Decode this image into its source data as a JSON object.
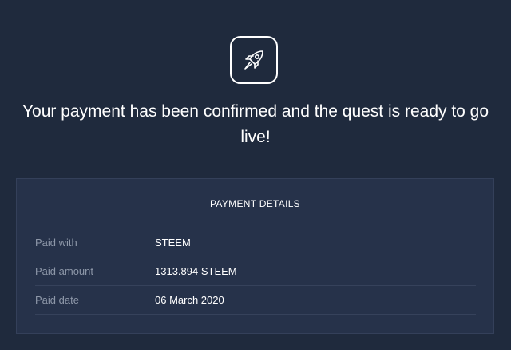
{
  "icon": "rocket-icon",
  "headline": "Your payment has been confirmed and the quest is ready to go live!",
  "payment_details": {
    "title": "PAYMENT DETAILS",
    "rows": [
      {
        "label": "Paid with",
        "value": "STEEM"
      },
      {
        "label": "Paid amount",
        "value": "1313.894 STEEM"
      },
      {
        "label": "Paid date",
        "value": "06 March 2020"
      }
    ]
  },
  "colors": {
    "background": "#1f2a3d",
    "card": "#26324a",
    "label": "#8d97a8",
    "text": "#ffffff"
  }
}
